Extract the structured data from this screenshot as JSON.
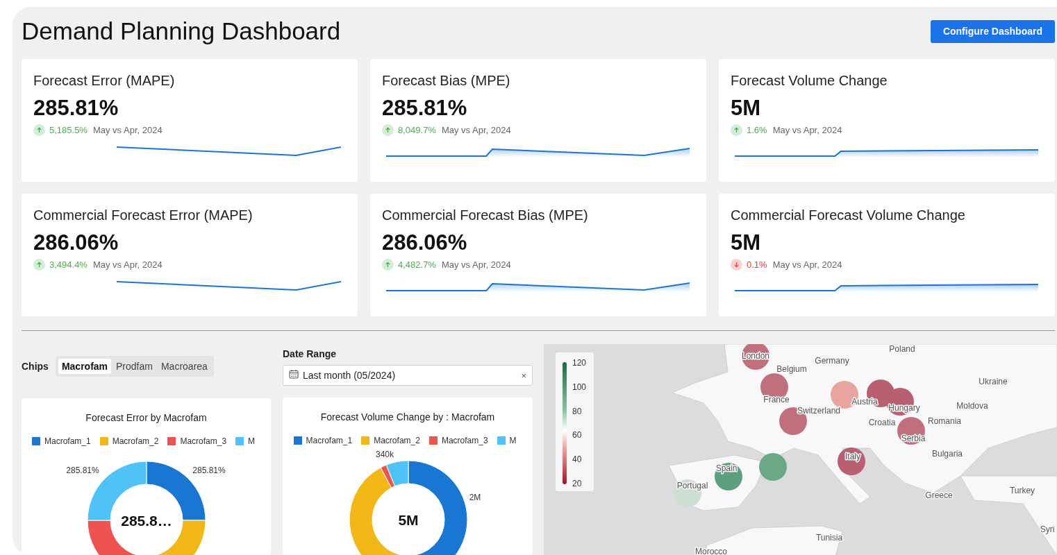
{
  "header": {
    "title": "Demand Planning Dashboard",
    "button": "Configure Dashboard"
  },
  "kpis": [
    {
      "title": "Forecast Error (MAPE)",
      "value": "285.81%",
      "delta": {
        "kind": "up",
        "text": "5,185.5%"
      },
      "period": "May vs Apr, 2024",
      "sparkline": {
        "kind": "dip"
      }
    },
    {
      "title": "Forecast Bias (MPE)",
      "value": "285.81%",
      "delta": {
        "kind": "up",
        "text": "8,049.7%"
      },
      "period": "May vs Apr, 2024",
      "sparkline": {
        "kind": "stepdip"
      }
    },
    {
      "title": "Forecast Volume Change",
      "value": "5M",
      "delta": {
        "kind": "up",
        "text": "1.6%"
      },
      "period": "May vs Apr, 2024",
      "sparkline": {
        "kind": "step"
      }
    },
    {
      "title": "Commercial Forecast Error (MAPE)",
      "value": "286.06%",
      "delta": {
        "kind": "up",
        "text": "3,494.4%"
      },
      "period": "May vs Apr, 2024",
      "sparkline": {
        "kind": "dip"
      }
    },
    {
      "title": "Commercial Forecast Bias (MPE)",
      "value": "286.06%",
      "delta": {
        "kind": "up",
        "text": "4,482.7%"
      },
      "period": "May vs Apr, 2024",
      "sparkline": {
        "kind": "stepdip"
      }
    },
    {
      "title": "Commercial Forecast Volume Change",
      "value": "5M",
      "delta": {
        "kind": "down",
        "text": "0.1%"
      },
      "period": "May vs Apr, 2024",
      "sparkline": {
        "kind": "step"
      }
    }
  ],
  "chips": {
    "label": "Chips",
    "items": [
      {
        "label": "Macrofam",
        "selected": true
      },
      {
        "label": "Prodfam",
        "selected": false
      },
      {
        "label": "Macroarea",
        "selected": false
      }
    ]
  },
  "date_range": {
    "label": "Date Range",
    "value": "Last month (05/2024)",
    "clear": "×"
  },
  "donuts": [
    {
      "title": "Forecast Error by Macrofam",
      "legend": [
        {
          "label": "Macrofam_1",
          "color": "#1976d2"
        },
        {
          "label": "Macrofam_2",
          "color": "#f2b817"
        },
        {
          "label": "Macrofam_3",
          "color": "#ef5350"
        },
        {
          "label": "M",
          "color": "#4fc3f7"
        }
      ],
      "labels": [
        "285.81%",
        "285.81%"
      ],
      "center": "285.8…",
      "kind": "equal"
    },
    {
      "title": "Forecast Volume Change by : Macrofam",
      "legend": [
        {
          "label": "Macrofam_1",
          "color": "#1976d2"
        },
        {
          "label": "Macrofam_2",
          "color": "#f2b817"
        },
        {
          "label": "Macrofam_3",
          "color": "#ef5350"
        },
        {
          "label": "M",
          "color": "#4fc3f7"
        }
      ],
      "labels": [
        "340k",
        "2M"
      ],
      "center": "5M",
      "kind": "volume"
    }
  ],
  "map": {
    "scale": [
      "120",
      "100",
      "80",
      "60",
      "40",
      "20"
    ],
    "bubbles": [
      {
        "color": "#c0707d"
      },
      {
        "color": "#c0707d"
      },
      {
        "color": "#c0707d"
      },
      {
        "color": "#e8a49f"
      },
      {
        "color": "#b8606f"
      },
      {
        "color": "#b8606f"
      },
      {
        "color": "#c0707d"
      },
      {
        "color": "#b8606f"
      },
      {
        "color": "#6aa886"
      },
      {
        "color": "#5e9f7d"
      },
      {
        "color": "#cbdfd3"
      }
    ],
    "labels": [
      "Poland",
      "Germany",
      "Belgium",
      "London",
      "Ukraine",
      "France",
      "Austria",
      "Hungary",
      "Moldova",
      "Switzerland",
      "Croatia",
      "Romania",
      "Serbia",
      "Italy",
      "Bulgaria",
      "Spain",
      "Portugal",
      "Greece",
      "Turkey",
      "Tunisia",
      "Morocco",
      "Syri"
    ]
  }
}
